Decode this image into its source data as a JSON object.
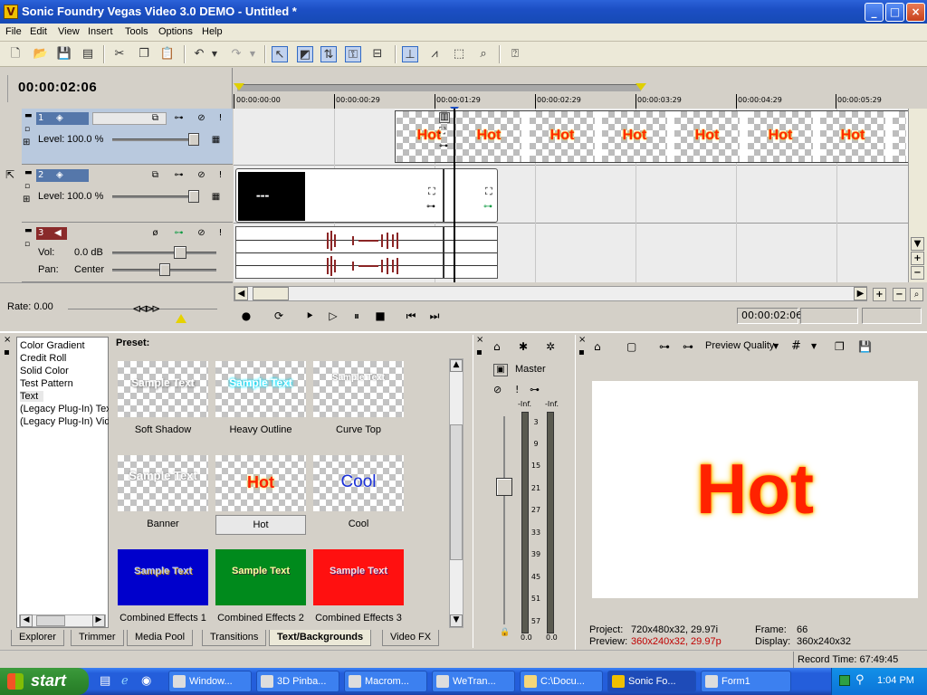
{
  "window": {
    "title": "Sonic Foundry Vegas Video 3.0 DEMO - Untitled *",
    "app_icon": "V",
    "min": "_",
    "max": "□",
    "close": "×"
  },
  "menu": [
    "File",
    "Edit",
    "View",
    "Insert",
    "Tools",
    "Options",
    "Help"
  ],
  "timecode": "00:00:02:06",
  "ruler": {
    "labels": [
      "00:00:00:00",
      "00:00:00:29",
      "00:00:01:29",
      "00:00:02:29",
      "00:00:03:29",
      "00:00:04:29",
      "00:00:05:29"
    ]
  },
  "tracks": [
    {
      "num": "1",
      "type": "video",
      "level_label": "Level:",
      "level_value": "100.0 %",
      "level_fraction": 1.0
    },
    {
      "num": "2",
      "type": "video",
      "level_label": "Level:",
      "level_value": "100.0 %",
      "level_fraction": 1.0
    },
    {
      "num": "3",
      "type": "audio",
      "vol_label": "Vol:",
      "vol_value": "0.0 dB",
      "pan_label": "Pan:",
      "pan_value": "Center"
    }
  ],
  "clip_text": "Hot",
  "rate": {
    "label": "Rate: 0.00"
  },
  "transport": {
    "time": "00:00:02:06"
  },
  "media_list": [
    "Color Gradient",
    "Credit Roll",
    "Solid Color",
    "Test Pattern",
    "Text",
    "(Legacy Plug-In) Text",
    "(Legacy Plug-In) Video"
  ],
  "preset_label": "Preset:",
  "presets": [
    {
      "name": "Soft Shadow",
      "sample": "Sample Text"
    },
    {
      "name": "Heavy Outline",
      "sample": "Sample Text"
    },
    {
      "name": "Curve Top",
      "sample": "Sample Text"
    },
    {
      "name": "Banner",
      "sample": "Sample Text"
    },
    {
      "name": "Hot",
      "sample": "Hot"
    },
    {
      "name": "Cool",
      "sample": "Cool"
    },
    {
      "name": "Combined Effects 1",
      "sample": "Sample Text"
    },
    {
      "name": "Combined Effects 2",
      "sample": "Sample Text"
    },
    {
      "name": "Combined Effects 3",
      "sample": "Sample Text"
    }
  ],
  "tabs": [
    "Explorer",
    "Trimmer",
    "Media Pool",
    "Transitions",
    "Text/Backgrounds",
    "Video FX"
  ],
  "active_tab": "Text/Backgrounds",
  "mixer": {
    "label": "Master",
    "inf_left": "-Inf.",
    "inf_right": "-Inf.",
    "db_marks": [
      "3",
      "9",
      "15",
      "21",
      "27",
      "33",
      "39",
      "45",
      "51",
      "57"
    ],
    "bottom_left": "0.0",
    "bottom_right": "0.0"
  },
  "preview": {
    "quality_label": "Preview Quality",
    "screen_text": "Hot",
    "project_label": "Project:",
    "project_value": "720x480x32, 29.97i",
    "preview_label": "Preview:",
    "preview_value": "360x240x32, 29.97p",
    "frame_label": "Frame:",
    "frame_value": "66",
    "display_label": "Display:",
    "display_value": "360x240x32"
  },
  "status": {
    "record_time": "Record Time: 67:49:45"
  },
  "taskbar": {
    "start": "start",
    "items": [
      "Window...",
      "3D Pinba...",
      "Macrom...",
      "WeTran...",
      "C:\\Docu...",
      "Sonic Fo...",
      "Form1"
    ],
    "clock": "1:04 PM"
  },
  "colors": {
    "accent_red": "#ff2a00",
    "glow": "#ffcc00",
    "titlebar": "#1c4fc4",
    "taskbar": "#245edb"
  }
}
